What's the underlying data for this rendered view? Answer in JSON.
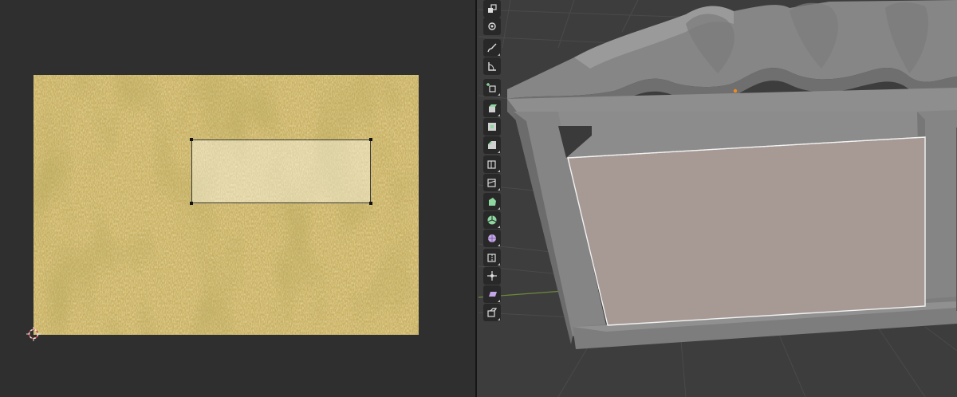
{
  "uv_editor": {
    "image_texture": "gold-foil-texture",
    "island_color": "#f7f3e6",
    "cursor": "2d-cursor-icon"
  },
  "viewport_3d": {
    "background_color": "#3d3d3d",
    "object": "roof-shelter-mesh",
    "selected_face_color": "#a79a94",
    "mesh_color": "#8f8f8f"
  },
  "toolbar": {
    "tools": [
      {
        "name": "select-box-tool-icon"
      },
      {
        "name": "cursor-tool-icon"
      },
      {
        "name": "annotate-tool-icon"
      },
      {
        "name": "measure-tool-icon"
      },
      {
        "name": "add-cube-tool-icon"
      },
      {
        "name": "extrude-region-tool-icon"
      },
      {
        "name": "inset-faces-tool-icon"
      },
      {
        "name": "bevel-tool-icon"
      },
      {
        "name": "loop-cut-tool-icon"
      },
      {
        "name": "knife-tool-icon"
      },
      {
        "name": "poly-build-tool-icon"
      },
      {
        "name": "spin-tool-icon"
      },
      {
        "name": "smooth-tool-icon"
      },
      {
        "name": "edge-slide-tool-icon"
      },
      {
        "name": "shrink-fatten-tool-icon"
      },
      {
        "name": "shear-tool-icon"
      },
      {
        "name": "rip-region-tool-icon"
      }
    ]
  }
}
